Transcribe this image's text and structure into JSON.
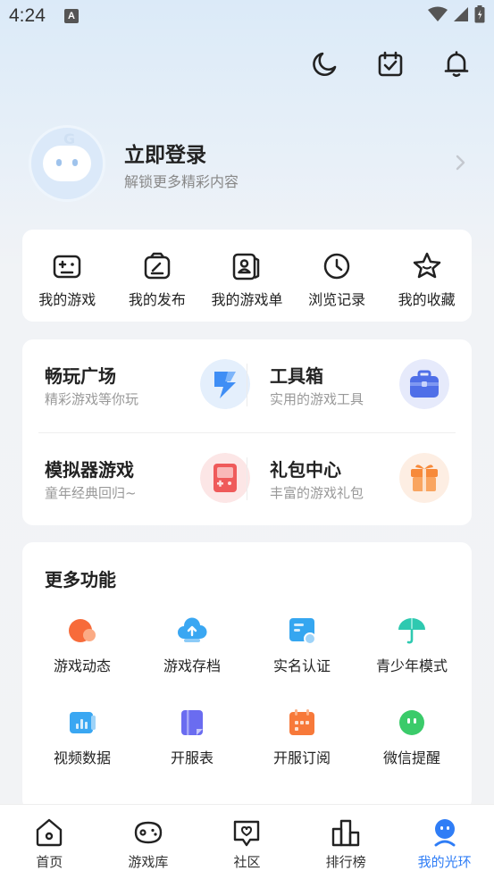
{
  "status": {
    "time": "4:24",
    "notification_glyph": "A"
  },
  "header_icons": [
    "moon-icon",
    "calendar-check-icon",
    "bell-icon"
  ],
  "profile": {
    "title": "立即登录",
    "subtitle": "解锁更多精彩内容"
  },
  "quick_actions": [
    {
      "label": "我的游戏",
      "icon": "gamepad-icon"
    },
    {
      "label": "我的发布",
      "icon": "publish-icon"
    },
    {
      "label": "我的游戏单",
      "icon": "game-list-icon"
    },
    {
      "label": "浏览记录",
      "icon": "clock-icon"
    },
    {
      "label": "我的收藏",
      "icon": "star-icon"
    }
  ],
  "features": [
    {
      "title": "畅玩广场",
      "subtitle": "精彩游戏等你玩",
      "icon": "lightning-icon",
      "color": "#3f8ef5"
    },
    {
      "title": "工具箱",
      "subtitle": "实用的游戏工具",
      "icon": "toolbox-icon",
      "color": "#4f6fe8"
    },
    {
      "title": "模拟器游戏",
      "subtitle": "童年经典回归~",
      "icon": "game-console-icon",
      "color": "#ef5a5a"
    },
    {
      "title": "礼包中心",
      "subtitle": "丰富的游戏礼包",
      "icon": "gift-icon",
      "color": "#f78a3a"
    }
  ],
  "more": {
    "title": "更多功能",
    "items": [
      {
        "label": "游戏动态",
        "icon": "game-news-icon",
        "color": "#f76b3a"
      },
      {
        "label": "游戏存档",
        "icon": "cloud-save-icon",
        "color": "#3aa7f2"
      },
      {
        "label": "实名认证",
        "icon": "id-card-icon",
        "color": "#35a6f0"
      },
      {
        "label": "青少年模式",
        "icon": "umbrella-icon",
        "color": "#2ec9b0"
      },
      {
        "label": "视频数据",
        "icon": "video-data-icon",
        "color": "#3aa7f2"
      },
      {
        "label": "开服表",
        "icon": "server-list-icon",
        "color": "#6a6cf0"
      },
      {
        "label": "开服订阅",
        "icon": "subscribe-calendar-icon",
        "color": "#f7793a"
      },
      {
        "label": "微信提醒",
        "icon": "wechat-icon",
        "color": "#3bcb6a"
      }
    ]
  },
  "tabbar": {
    "items": [
      {
        "label": "首页",
        "icon": "home-icon",
        "active": false
      },
      {
        "label": "游戏库",
        "icon": "game-library-icon",
        "active": false
      },
      {
        "label": "社区",
        "icon": "community-icon",
        "active": false
      },
      {
        "label": "排行榜",
        "icon": "ranking-icon",
        "active": false
      },
      {
        "label": "我的光环",
        "icon": "profile-icon",
        "active": true
      }
    ],
    "active_color": "#2f7df6"
  }
}
